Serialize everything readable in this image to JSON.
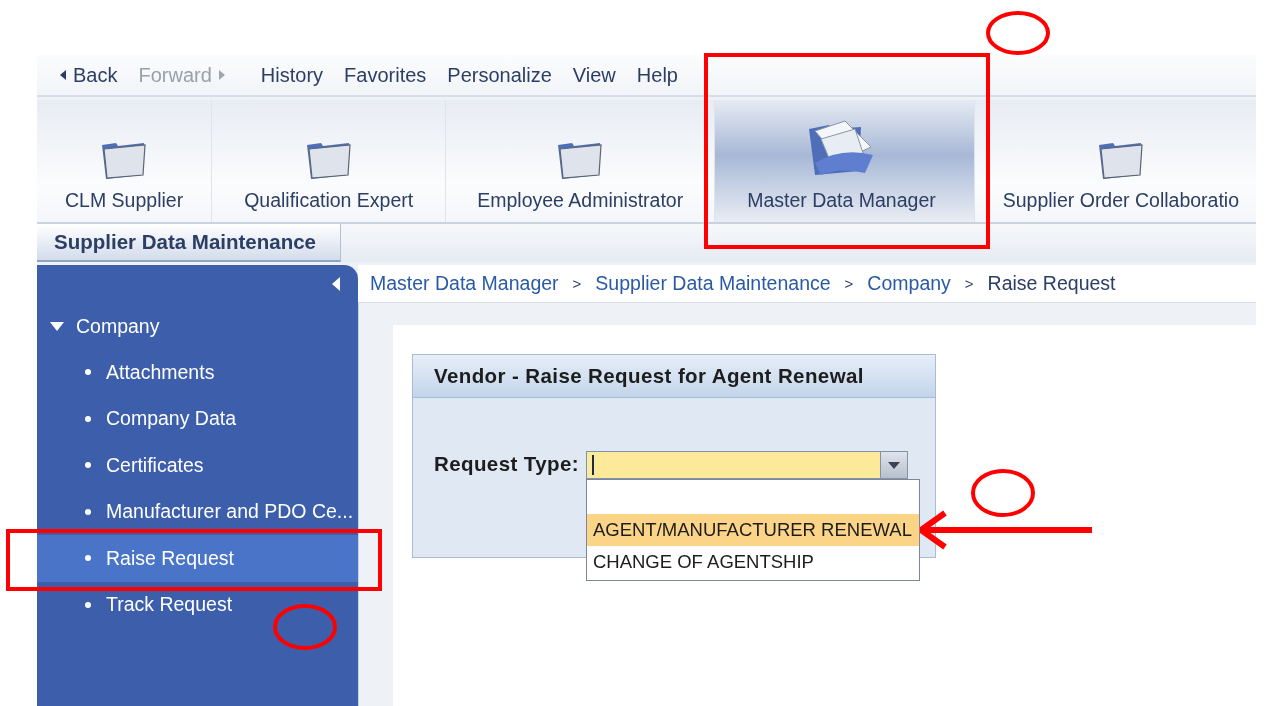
{
  "menu_bar": [
    {
      "label": "Back",
      "kind": "back",
      "disabled": false
    },
    {
      "label": "Forward",
      "kind": "forward",
      "disabled": true
    },
    {
      "label": "History",
      "kind": "menu",
      "disabled": false
    },
    {
      "label": "Favorites",
      "kind": "menu",
      "disabled": false
    },
    {
      "label": "Personalize",
      "kind": "menu",
      "disabled": false
    },
    {
      "label": "View",
      "kind": "menu",
      "disabled": false
    },
    {
      "label": "Help",
      "kind": "menu",
      "disabled": false
    }
  ],
  "launchpad": [
    {
      "label": "CLM Supplier",
      "kind": "folder",
      "selected": false
    },
    {
      "label": "Qualification Expert",
      "kind": "folder",
      "selected": false
    },
    {
      "label": "Employee Administrator",
      "kind": "folder",
      "selected": false
    },
    {
      "label": "Master Data Manager",
      "kind": "documents",
      "selected": true
    },
    {
      "label": "Supplier Order Collaboratio",
      "kind": "folder",
      "selected": false
    }
  ],
  "sub_tabs": [
    {
      "label": "Supplier Data Maintenance",
      "selected": true
    }
  ],
  "sidebar": {
    "items": [
      {
        "label": "Company",
        "expanded": true,
        "selected": false,
        "children": [
          {
            "label": "Attachments",
            "selected": false
          },
          {
            "label": "Company Data",
            "selected": false
          },
          {
            "label": "Certificates",
            "selected": false
          },
          {
            "label": "Manufacturer and PDO Ce...",
            "selected": false
          },
          {
            "label": "Raise Request",
            "selected": true
          },
          {
            "label": "Track Request",
            "selected": false
          }
        ]
      }
    ]
  },
  "breadcrumb": [
    "Master Data Manager",
    "Supplier Data Maintenance",
    "Company",
    "Raise Request"
  ],
  "breadcrumb_separator": ">",
  "form": {
    "title": "Vendor - Raise Request for Agent Renewal",
    "field_label": "Request Type:",
    "dropdown_options": [
      {
        "label": "AGENT/MANUFACTURER RENEWAL",
        "selected": true
      },
      {
        "label": "CHANGE OF AGENTSHIP",
        "selected": false
      }
    ]
  }
}
